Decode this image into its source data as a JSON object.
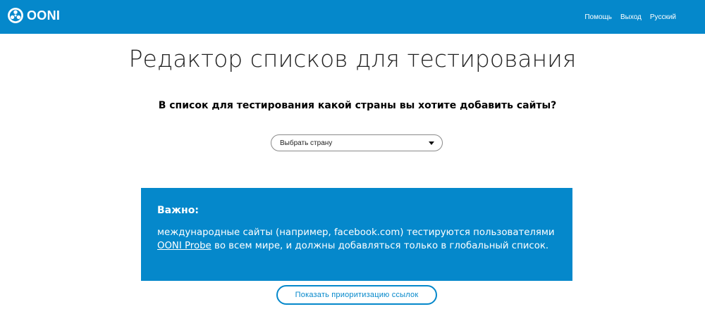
{
  "navbar": {
    "logo_icon": "ooni-logo-icon",
    "logo_text": "OONI",
    "links": [
      {
        "label": "Помощь"
      },
      {
        "label": "Выход"
      },
      {
        "label": "Русский"
      }
    ],
    "background_color": "#0588cb"
  },
  "main": {
    "title": "Редактор списков для тестирования",
    "question": "В список для тестирования какой страны вы хотите добавить сайты?",
    "country_select": {
      "value": "Выбрать страну",
      "icon": "caret-down-icon"
    },
    "notice": {
      "title": "Важно:",
      "body_before_link": "международные сайты (например, facebook.com) тестируются пользователями ",
      "link_text": "OONI Probe",
      "body_after_link": " во всем мире, и должны добавляться только в глобальный список."
    },
    "priority_button_label": "Показать приоритизацию ссылок"
  }
}
